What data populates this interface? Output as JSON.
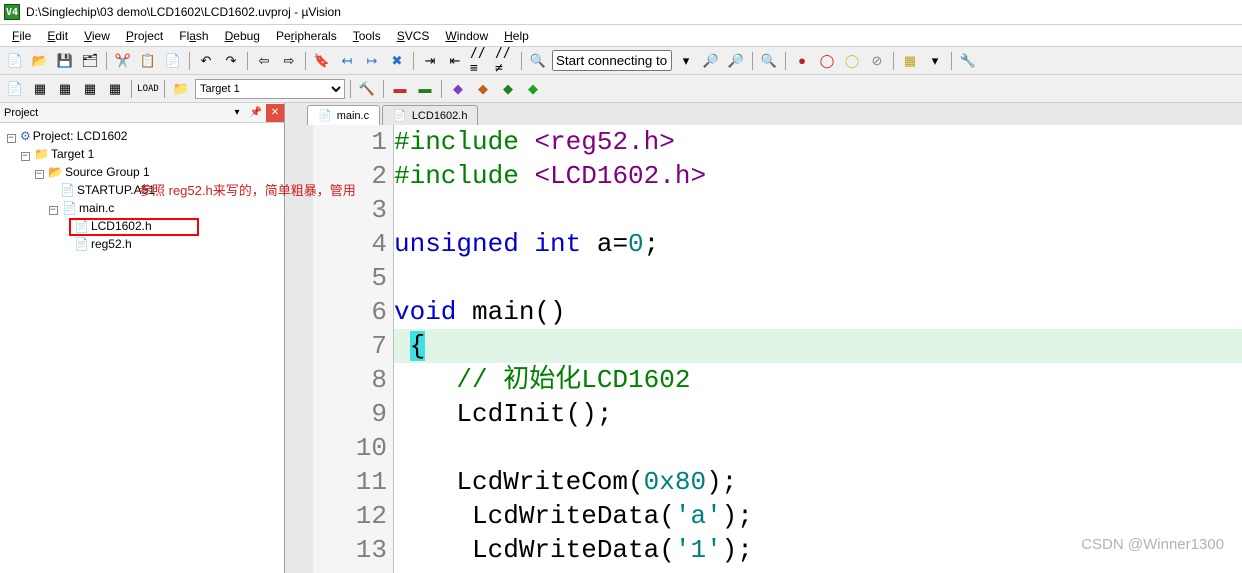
{
  "title": {
    "path": "D:\\Singlechip\\03 demo\\LCD1602\\LCD1602.uvproj - µVision",
    "app_short": "V4"
  },
  "menu": {
    "items": [
      "File",
      "Edit",
      "View",
      "Project",
      "Flash",
      "Debug",
      "Peripherals",
      "Tools",
      "SVCS",
      "Window",
      "Help"
    ]
  },
  "toolbar": {
    "find_placeholder": "Start connecting to the s",
    "target_value": "Target 1"
  },
  "project_panel": {
    "title": "Project",
    "tree": {
      "root": "Project: LCD1602",
      "target": "Target 1",
      "group": "Source Group 1",
      "files": [
        "STARTUP.A51",
        "main.c"
      ],
      "main_children": [
        "LCD1602.h",
        "reg52.h"
      ]
    }
  },
  "annotation": {
    "text": "参照  reg52.h来写的，简单粗暴，管用"
  },
  "tabs": {
    "items": [
      {
        "label": "main.c",
        "active": true
      },
      {
        "label": "LCD1602.h",
        "active": false
      }
    ]
  },
  "code": {
    "lines": [
      {
        "n": 1,
        "tokens": [
          [
            "pp",
            "#include "
          ],
          [
            "inc",
            "<reg52.h>"
          ]
        ]
      },
      {
        "n": 2,
        "tokens": [
          [
            "pp",
            "#include "
          ],
          [
            "inc",
            "<LCD1602.h>"
          ]
        ]
      },
      {
        "n": 3,
        "tokens": []
      },
      {
        "n": 4,
        "tokens": [
          [
            "kw",
            "unsigned int"
          ],
          [
            "",
            " a="
          ],
          [
            "num",
            "0"
          ],
          [
            "",
            ";"
          ]
        ]
      },
      {
        "n": 5,
        "tokens": []
      },
      {
        "n": 6,
        "tokens": [
          [
            "kw",
            "void"
          ],
          [
            "",
            " main()"
          ]
        ]
      },
      {
        "n": 7,
        "selected": true,
        "cursor": true,
        "tokens": [
          [
            "",
            " "
          ],
          [
            "cur",
            "{"
          ]
        ]
      },
      {
        "n": 8,
        "tokens": [
          [
            "",
            "    "
          ],
          [
            "cmt",
            "// 初始化LCD1602"
          ]
        ]
      },
      {
        "n": 9,
        "tokens": [
          [
            "",
            "    LcdInit();"
          ]
        ]
      },
      {
        "n": 10,
        "tokens": []
      },
      {
        "n": 11,
        "tokens": [
          [
            "",
            "    LcdWriteCom("
          ],
          [
            "num",
            "0x80"
          ],
          [
            "",
            ");"
          ]
        ]
      },
      {
        "n": 12,
        "tokens": [
          [
            "",
            "     LcdWriteData("
          ],
          [
            "str",
            "'a'"
          ],
          [
            "",
            ");"
          ]
        ]
      },
      {
        "n": 13,
        "tokens": [
          [
            "",
            "     LcdWriteData("
          ],
          [
            "str",
            "'1'"
          ],
          [
            "",
            ");"
          ]
        ],
        "cut": true
      }
    ]
  },
  "watermark": "CSDN @Winner1300"
}
